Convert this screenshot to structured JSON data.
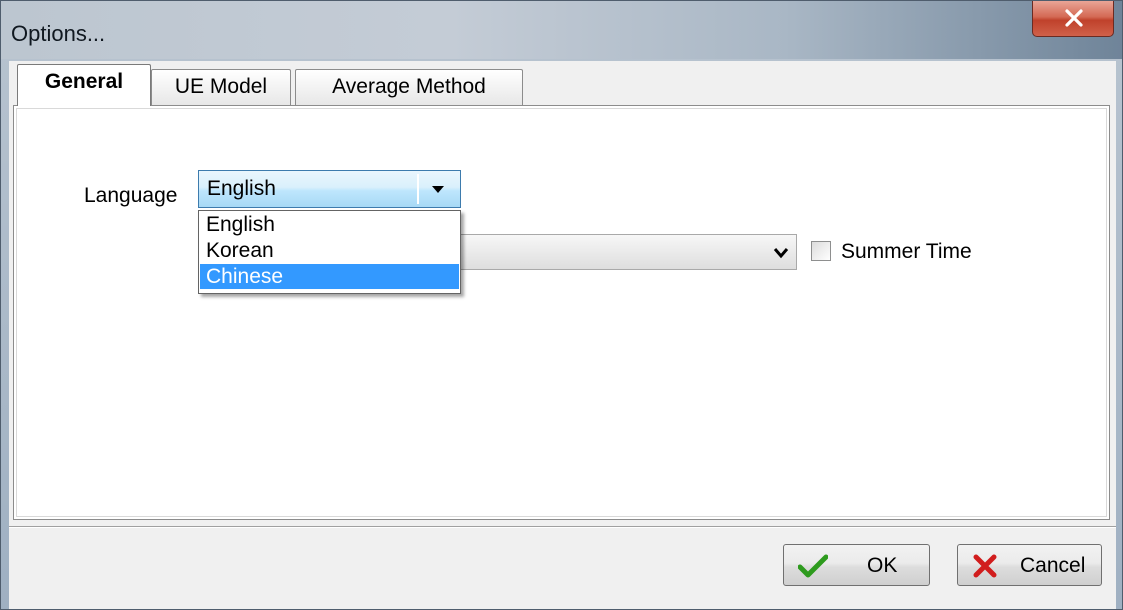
{
  "window": {
    "title": "Options...",
    "close_symbol": "x"
  },
  "tabs": [
    {
      "label": "General",
      "active": true
    },
    {
      "label": "UE Model",
      "active": false
    },
    {
      "label": "Average Method",
      "active": false
    }
  ],
  "general": {
    "language_label": "Language",
    "language_value": "English",
    "language_options": [
      "English",
      "Korean",
      "Chinese"
    ],
    "highlighted_option": "Chinese",
    "timezone_value": "",
    "summer_time_label": "Summer Time",
    "summer_time_checked": false
  },
  "buttons": {
    "ok_label": "OK",
    "cancel_label": "Cancel"
  },
  "icons": {
    "ok": "check-icon",
    "cancel": "x-icon",
    "combo": "chevron-down-icon"
  },
  "colors": {
    "selection": "#3399ff",
    "close_button": "#c0422b",
    "ok_check": "#2e9b1e",
    "cancel_x": "#d11d1d"
  }
}
